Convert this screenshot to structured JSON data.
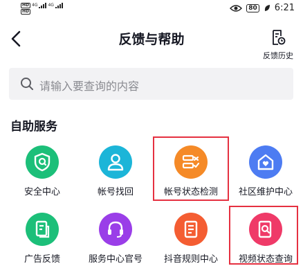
{
  "status_bar": {
    "network_left": "HD",
    "signal_1": "4G",
    "signal_2": "4G",
    "battery": "80",
    "time": "6:21"
  },
  "header": {
    "title": "反馈与帮助",
    "history_label": "反馈历史"
  },
  "search": {
    "placeholder": "请输入要查询的内容"
  },
  "section": {
    "title": "自助服务"
  },
  "services": [
    {
      "label": "安全中心",
      "color": "#1cbf79",
      "icon": "shield-icon"
    },
    {
      "label": "帐号找回",
      "color": "#1cb5d8",
      "icon": "user-icon"
    },
    {
      "label": "帐号状态检测",
      "color": "#f58a27",
      "icon": "checklist-icon"
    },
    {
      "label": "社区维护中心",
      "color": "#4d7cf2",
      "icon": "home-heart-icon"
    },
    {
      "label": "广告反馈",
      "color": "#1cbf79",
      "icon": "document-icon"
    },
    {
      "label": "服务中心官号",
      "color": "#9a3ee8",
      "icon": "headset-icon"
    },
    {
      "label": "抖音规则中心",
      "color": "#f45d32",
      "icon": "rules-icon"
    },
    {
      "label": "视频状态查询",
      "color": "#ef3a68",
      "icon": "video-search-icon"
    }
  ]
}
